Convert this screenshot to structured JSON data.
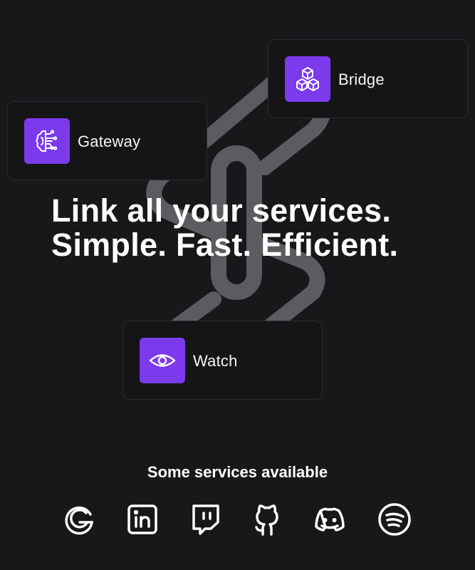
{
  "headline": {
    "line1": "Link all your services.",
    "line2": "Simple. Fast. Efficient."
  },
  "cards": {
    "bridge": {
      "label": "Bridge",
      "icon": "cubes-icon"
    },
    "gateway": {
      "label": "Gateway",
      "icon": "brain-circuit-icon"
    },
    "watch": {
      "label": "Watch",
      "icon": "eye-icon"
    }
  },
  "services": {
    "title": "Some services available",
    "items": [
      {
        "name": "Google",
        "icon": "google-icon"
      },
      {
        "name": "LinkedIn",
        "icon": "linkedin-icon"
      },
      {
        "name": "Twitch",
        "icon": "twitch-icon"
      },
      {
        "name": "GitHub",
        "icon": "github-icon"
      },
      {
        "name": "Discord",
        "icon": "discord-icon"
      },
      {
        "name": "Spotify",
        "icon": "spotify-icon"
      }
    ]
  },
  "colors": {
    "background": "#18181a",
    "accent": "#7c3aed",
    "card_border": "#2a2a2e",
    "link_gray": "#5c5c60"
  }
}
